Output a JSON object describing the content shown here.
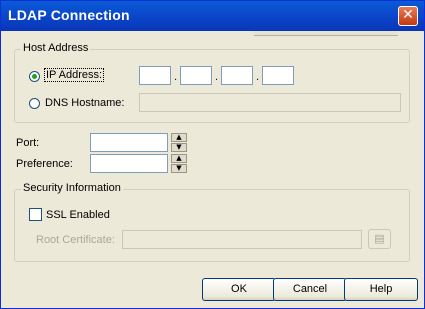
{
  "window": {
    "title": "LDAP Connection",
    "close_label": "✕"
  },
  "host_address": {
    "group_label": "Host Address",
    "ip_radio_label": "IP Address:",
    "ip_radio_checked": true,
    "ip_octets": [
      "",
      "",
      "",
      ""
    ],
    "ip_separator": ".",
    "dns_radio_label": "DNS Hostname:",
    "dns_value": ""
  },
  "port": {
    "label": "Port:",
    "value": ""
  },
  "preference": {
    "label": "Preference:",
    "value": ""
  },
  "security": {
    "group_label": "Security Information",
    "ssl_label": "SSL Enabled",
    "ssl_checked": false,
    "root_cert_label": "Root Certificate:",
    "root_cert_value": ""
  },
  "buttons": {
    "ok": "OK",
    "cancel": "Cancel",
    "help": "Help"
  },
  "icons": {
    "close": "close-icon",
    "spin_up": "up-arrow-icon",
    "spin_down": "down-arrow-icon",
    "browse": "file-browse-icon"
  }
}
